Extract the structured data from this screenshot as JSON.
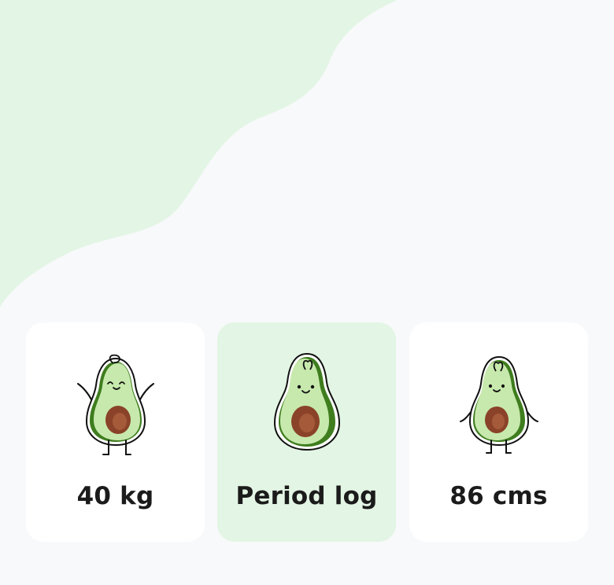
{
  "colors": {
    "page_bg": "#f8f9fb",
    "wave": "#e3f5e4",
    "card": "#ffffff",
    "card_selected": "#e3f5e4",
    "avocado_flesh": "#c7e9ad",
    "avocado_skin": "#3f7d1f",
    "avocado_pit": "#8a4328",
    "text": "#1b1b1b"
  },
  "options": [
    {
      "label": "40 kg",
      "icon": "avocado-cheering-icon",
      "selected": false
    },
    {
      "label": "Period log",
      "icon": "avocado-smiling-icon",
      "selected": true
    },
    {
      "label": "86 cms",
      "icon": "avocado-standing-icon",
      "selected": false
    }
  ]
}
